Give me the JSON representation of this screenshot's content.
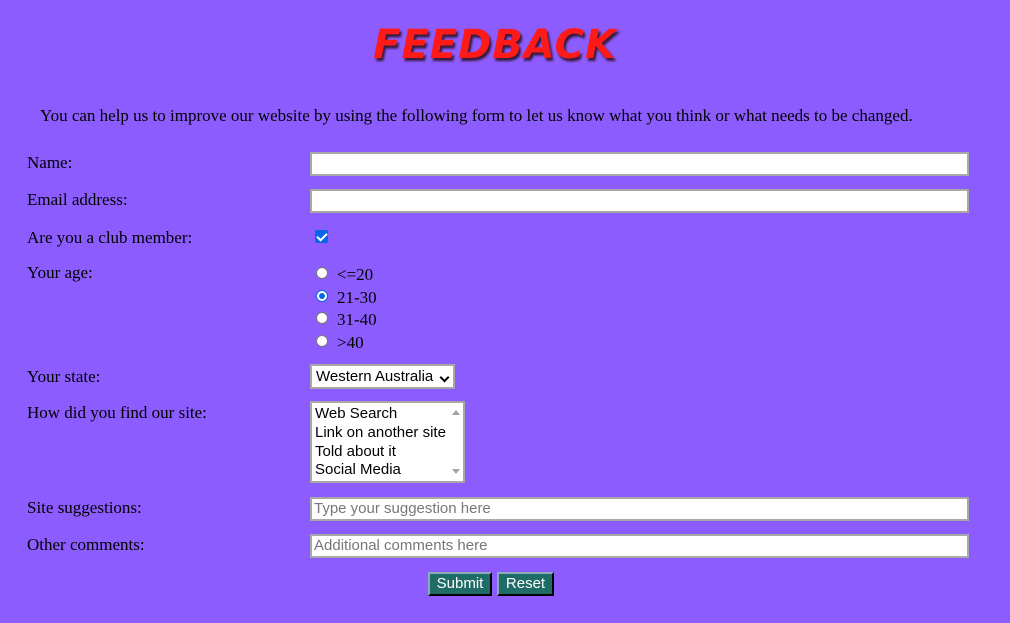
{
  "page": {
    "title": "FEEDBACK",
    "intro": "You can help us to improve our website by using the following form to let us know what you think or what needs to be changed."
  },
  "form": {
    "name_label": "Name:",
    "name_value": "",
    "email_label": "Email address:",
    "email_value": "",
    "member_label": "Are you a club member:",
    "member_checked": true,
    "age_label": "Your age:",
    "age_options": [
      "<=20",
      "21-30",
      "31-40",
      ">40"
    ],
    "age_selected": "21-30",
    "state_label": "Your state:",
    "state_selected": "Western Australia",
    "find_label": "How did you find our site:",
    "find_options": [
      "Web Search",
      "Link on another site",
      "Told about it",
      "Social Media"
    ],
    "suggestions_label": "Site suggestions:",
    "suggestions_placeholder": "Type your suggestion here",
    "comments_label": "Other comments:",
    "comments_placeholder": "Additional comments here",
    "submit_label": "Submit",
    "reset_label": "Reset"
  },
  "colors": {
    "background": "#8c5cff",
    "title": "#ff1a1a",
    "button": "#1f6b66",
    "accent": "#0a66e8"
  },
  "icons": {
    "select_arrow": "chevron-down-icon",
    "checkbox_mark": "checkmark-icon"
  }
}
